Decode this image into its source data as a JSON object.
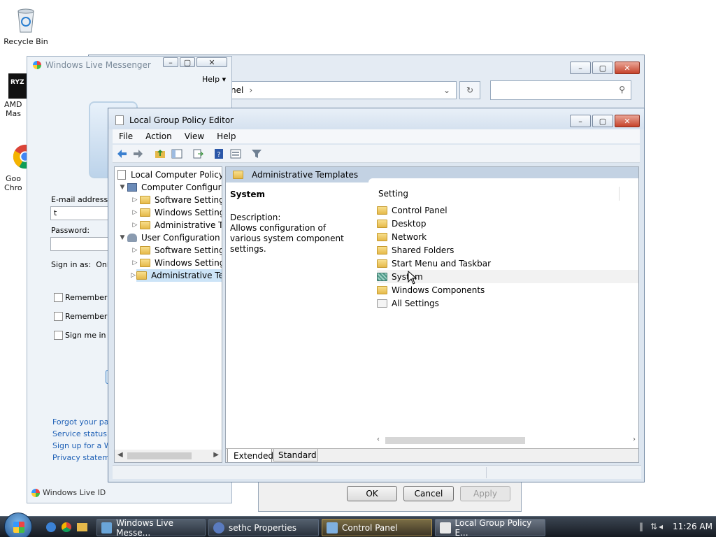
{
  "desktop": {
    "recycle_bin_label": "Recycle Bin",
    "amd_label_1": "AMD",
    "amd_label_2": "Mas",
    "chrome_label_1": "Goo",
    "chrome_label_2": "Chro"
  },
  "messenger": {
    "title": "Windows Live Messenger",
    "help_label": "Help",
    "email_label": "E-mail address:",
    "email_value": "t",
    "password_label": "Password:",
    "signin_as_label": "Sign in as:",
    "signin_as_value": "Online",
    "remember_me_1": "Remember m",
    "remember_me_2": "Remember m",
    "sign_me_in": "Sign me in au",
    "links": [
      "Forgot your pass",
      "Service status",
      "Sign up for a Wi",
      "Privacy statemen"
    ],
    "footer": "Windows Live ID"
  },
  "control_panel": {
    "address_text": "nel",
    "address_sep": "›"
  },
  "sethc_dialog": {
    "ok_label": "OK",
    "cancel_label": "Cancel",
    "apply_label": "Apply"
  },
  "gpedit": {
    "title": "Local Group Policy Editor",
    "menu": [
      "File",
      "Action",
      "View",
      "Help"
    ],
    "tree": {
      "root": "Local Computer Policy",
      "computer_config": "Computer Configura",
      "cc_software": "Software Settings",
      "cc_windows": "Windows Setting",
      "cc_admin": "Administrative Te",
      "user_config": "User Configuration",
      "uc_software": "Software Settings",
      "uc_windows": "Windows Setting",
      "uc_admin": "Administrative Te"
    },
    "header_title": "Administrative Templates",
    "detail_title": "System",
    "description_label": "Description:",
    "description_text": "Allows configuration of various system component settings.",
    "column_header": "Setting",
    "settings": [
      "Control Panel",
      "Desktop",
      "Network",
      "Shared Folders",
      "Start Menu and Taskbar",
      "System",
      "Windows Components",
      "All Settings"
    ],
    "tabs": [
      "Extended",
      "Standard"
    ]
  },
  "taskbar": {
    "tasks": [
      "Windows Live Messe...",
      "sethc Properties",
      "Control Panel",
      "Local Group Policy E..."
    ],
    "clock": "11:26 AM"
  },
  "colors": {
    "accent": "#1d5fb5",
    "tree_selected": "#cce4f7",
    "taskbar": "#1e242c"
  }
}
